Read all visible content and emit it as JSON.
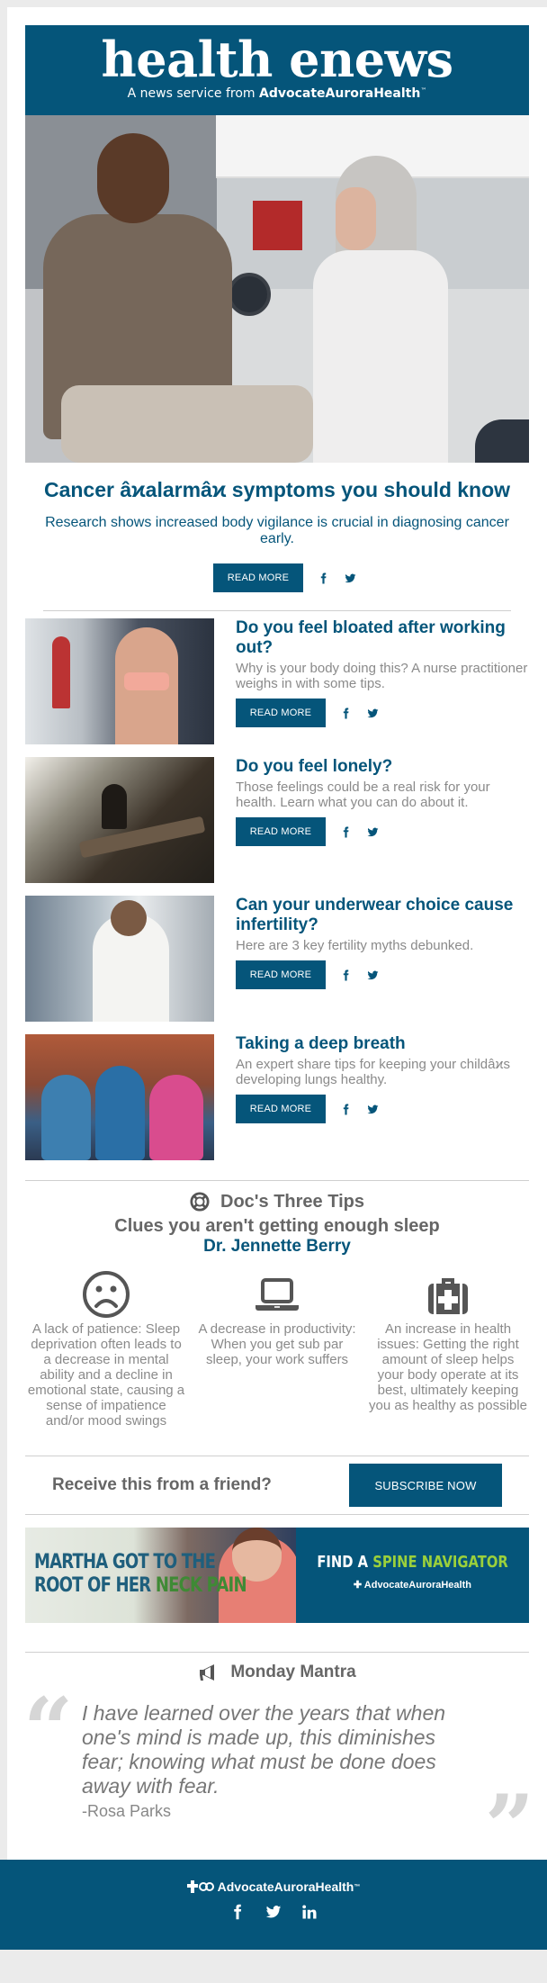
{
  "masthead": {
    "brand": "health enews",
    "tagline_prefix": "A news service from ",
    "tagline_org": "AdvocateAuroraHealth",
    "tagline_tm": "™"
  },
  "hero_image": {
    "alt": "Clinician taking a man's blood pressure in an exam room"
  },
  "feature": {
    "title": "Cancer âϰalarmâϰ symptoms you should know",
    "summary": "Research shows increased body vigilance is crucial in diagnosing cancer early.",
    "read_more": "READ MORE"
  },
  "stories": [
    {
      "title": "Do you feel bloated after working out?",
      "summary": "Why is your body doing this? A nurse practitioner weighs in with some tips.",
      "read_more": "READ MORE",
      "image_alt": "Smiling woman resting hands on knees in a gym"
    },
    {
      "title": "Do you feel lonely?",
      "summary": "Those feelings could be a real risk for your health. Learn what you can do about it.",
      "read_more": "READ MORE",
      "image_alt": "Person sitting alone on a bench"
    },
    {
      "title": "Can your underwear choice cause infertility?",
      "summary": "Here are 3 key fertility myths debunked.",
      "read_more": "READ MORE",
      "image_alt": "Pregnant woman by a window"
    },
    {
      "title": "Taking a deep breath",
      "summary": "An expert share tips for keeping your childâϰs developing lungs healthy.",
      "read_more": "READ MORE",
      "image_alt": "Three smiling children sitting together"
    }
  ],
  "tips": {
    "heading": "Doc's Three Tips",
    "subtitle": "Clues you aren't getting enough sleep",
    "author": "Dr. Jennette Berry",
    "items": [
      {
        "icon": "frown-icon",
        "text": "A lack of patience: Sleep deprivation often leads to a decrease in mental ability and a decline in emotional state, causing a sense of impatience and/or mood swings"
      },
      {
        "icon": "laptop-icon",
        "text": "A decrease in productivity: When you get sub par sleep, your work suffers"
      },
      {
        "icon": "medkit-icon",
        "text": "An increase in health issues: Getting the right amount of sleep helps your body operate at its best, ultimately keeping you as healthy as possible"
      }
    ]
  },
  "subscribe": {
    "question": "Receive this from a friend?",
    "button": "SUBSCRIBE NOW"
  },
  "banner": {
    "line1": "MARTHA GOT TO THE",
    "line2_a": "ROOT OF HER ",
    "line2_b": "NECK PAIN",
    "cta_a": "FIND A ",
    "cta_b": "SPINE NAVIGATOR",
    "logo": "AdvocateAuroraHealth"
  },
  "mantra": {
    "heading": "Monday Mantra",
    "quote": "I have learned over the years that when one's mind is made up, this diminishes fear; knowing what must be done does away with fear.",
    "attribution": "-Rosa Parks",
    "open_mark": "“",
    "close_mark": "”"
  },
  "footer": {
    "logo": "AdvocateAuroraHealth",
    "tm": "™"
  },
  "colors": {
    "brand_blue": "#05557a",
    "banner_green": "#9bd03b",
    "body_gray": "#8a8a8a",
    "heading_gray": "#666666",
    "page_bg": "#ebebeb"
  }
}
